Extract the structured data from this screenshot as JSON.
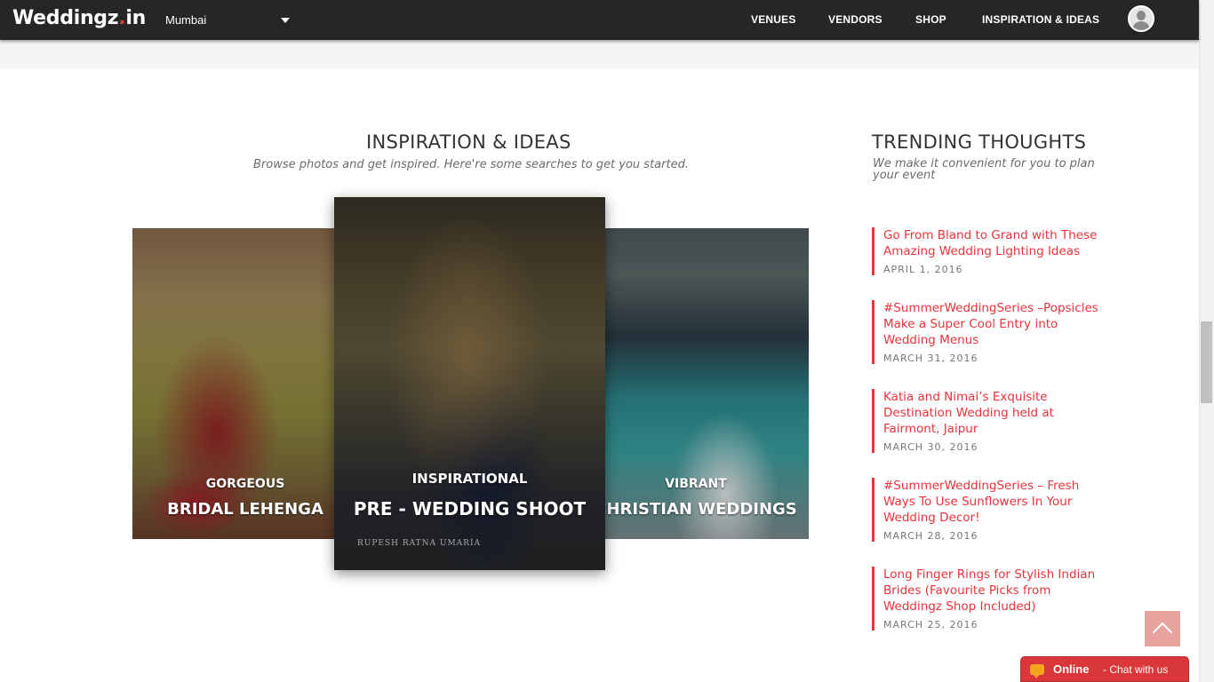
{
  "header": {
    "logo_main": "Weddingz",
    "logo_accent": ".",
    "logo_tail": "in",
    "city": "Mumbai",
    "nav": [
      "VENUES",
      "VENDORS",
      "SHOP",
      "INSPIRATION & IDEAS"
    ]
  },
  "inspiration": {
    "title": "INSPIRATION & IDEAS",
    "subtitle": "Browse photos and get inspired. Here're some searches to get you started.",
    "cards": [
      {
        "small": "GORGEOUS",
        "big": "BRIDAL LEHENGA"
      },
      {
        "small": "INSPIRATIONAL",
        "big": "PRE - WEDDING SHOOT",
        "credit": "RUPESH RATNA UMARIA"
      },
      {
        "small": "VIBRANT",
        "big": "CHRISTIAN WEDDINGS"
      }
    ]
  },
  "trending": {
    "title": "TRENDING THOUGHTS",
    "subtitle": "We make it convenient for you to plan your event",
    "items": [
      {
        "title": "Go From Bland to Grand with These Amazing Wedding Lighting Ideas",
        "date": "APRIL 1, 2016"
      },
      {
        "title": "#SummerWeddingSeries –Popsicles Make a Super Cool Entry into Wedding Menus",
        "date": "MARCH 31, 2016"
      },
      {
        "title": "Katia and Nimai’s Exquisite Destination Wedding held at Fairmont, Jaipur",
        "date": "MARCH 30, 2016"
      },
      {
        "title": "#SummerWeddingSeries – Fresh Ways To Use Sunflowers In Your Wedding Decor!",
        "date": "MARCH 28, 2016"
      },
      {
        "title": "Long Finger Rings for Stylish Indian Brides (Favourite Picks from Weddingz Shop Included)",
        "date": "MARCH 25, 2016"
      }
    ]
  },
  "chat": {
    "status": "Online",
    "text": "- Chat with us"
  },
  "colors": {
    "accent": "#e8343c",
    "header_bg": "#262626",
    "chat_bg": "#d9373a"
  },
  "icons": {
    "city_dropdown": "caret-down-icon",
    "profile": "user-avatar-icon",
    "back_to_top": "chevron-up-icon",
    "chat": "chat-bubble-icon"
  }
}
